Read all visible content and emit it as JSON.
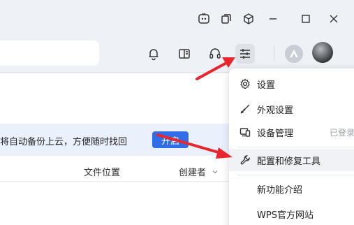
{
  "toolbar": {
    "icons": [
      "bell-icon",
      "reader-icon",
      "headset-icon",
      "sliders-icon"
    ]
  },
  "banner": {
    "text": "将自动备份上云，方便随时找回",
    "button": "开启"
  },
  "columns": {
    "location": "文件位置",
    "creator": "创建者"
  },
  "menu": {
    "items": [
      {
        "label": "设置",
        "icon": "gear-icon"
      },
      {
        "label": "外观设置",
        "icon": "brush-icon"
      },
      {
        "label": "设备管理",
        "icon": "device-icon",
        "status": "已登录"
      },
      {
        "label": "配置和修复工具",
        "icon": "wrench-icon",
        "highlighted": true
      },
      {
        "label": "新功能介绍"
      },
      {
        "label": "WPS官方网站"
      }
    ]
  },
  "colors": {
    "accent": "#2f6ee8",
    "annotation": "#e8262b",
    "banner_bg": "#eaf1fd"
  }
}
